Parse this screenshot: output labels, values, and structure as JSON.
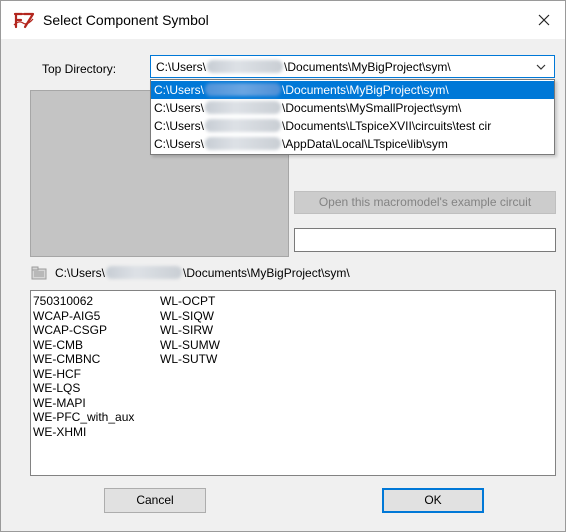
{
  "window": {
    "title": "Select Component Symbol"
  },
  "top_directory": {
    "label": "Top Directory:",
    "selected": {
      "prefix": "C:\\Users\\",
      "suffix": "\\Documents\\MyBigProject\\sym\\"
    },
    "options": [
      {
        "prefix": "C:\\Users\\",
        "suffix": "\\Documents\\MyBigProject\\sym\\",
        "selected": true
      },
      {
        "prefix": "C:\\Users\\",
        "suffix": "\\Documents\\MySmallProject\\sym\\",
        "selected": false
      },
      {
        "prefix": "C:\\Users\\",
        "suffix": "\\Documents\\LTspiceXVII\\circuits\\test cir",
        "selected": false
      },
      {
        "prefix": "C:\\Users\\",
        "suffix": "\\AppData\\Local\\LTspice\\lib\\sym",
        "selected": false
      }
    ]
  },
  "example_button_label": "Open this macromodel's example circuit",
  "description_value": "",
  "current_path": {
    "prefix": "C:\\Users\\",
    "suffix": "\\Documents\\MyBigProject\\sym\\"
  },
  "symbols": {
    "column1": [
      "750310062",
      "WCAP-AIG5",
      "WCAP-CSGP",
      "WE-CMB",
      "WE-CMBNC",
      "WE-HCF",
      "WE-LQS",
      "WE-MAPI",
      "WE-PFC_with_aux",
      "WE-XHMI"
    ],
    "column2": [
      "WL-OCPT",
      "WL-SIQW",
      "WL-SIRW",
      "WL-SUMW",
      "WL-SUTW"
    ]
  },
  "buttons": {
    "cancel": "Cancel",
    "ok": "OK"
  },
  "colors": {
    "accent": "#0078d7",
    "preview_bg": "#c4c4c4",
    "window_bg": "#f0f0f0"
  },
  "icons": {
    "app": "ltspice-logo-icon",
    "close": "close-icon",
    "dropdown": "chevron-down-icon",
    "folder": "folder-icon"
  }
}
